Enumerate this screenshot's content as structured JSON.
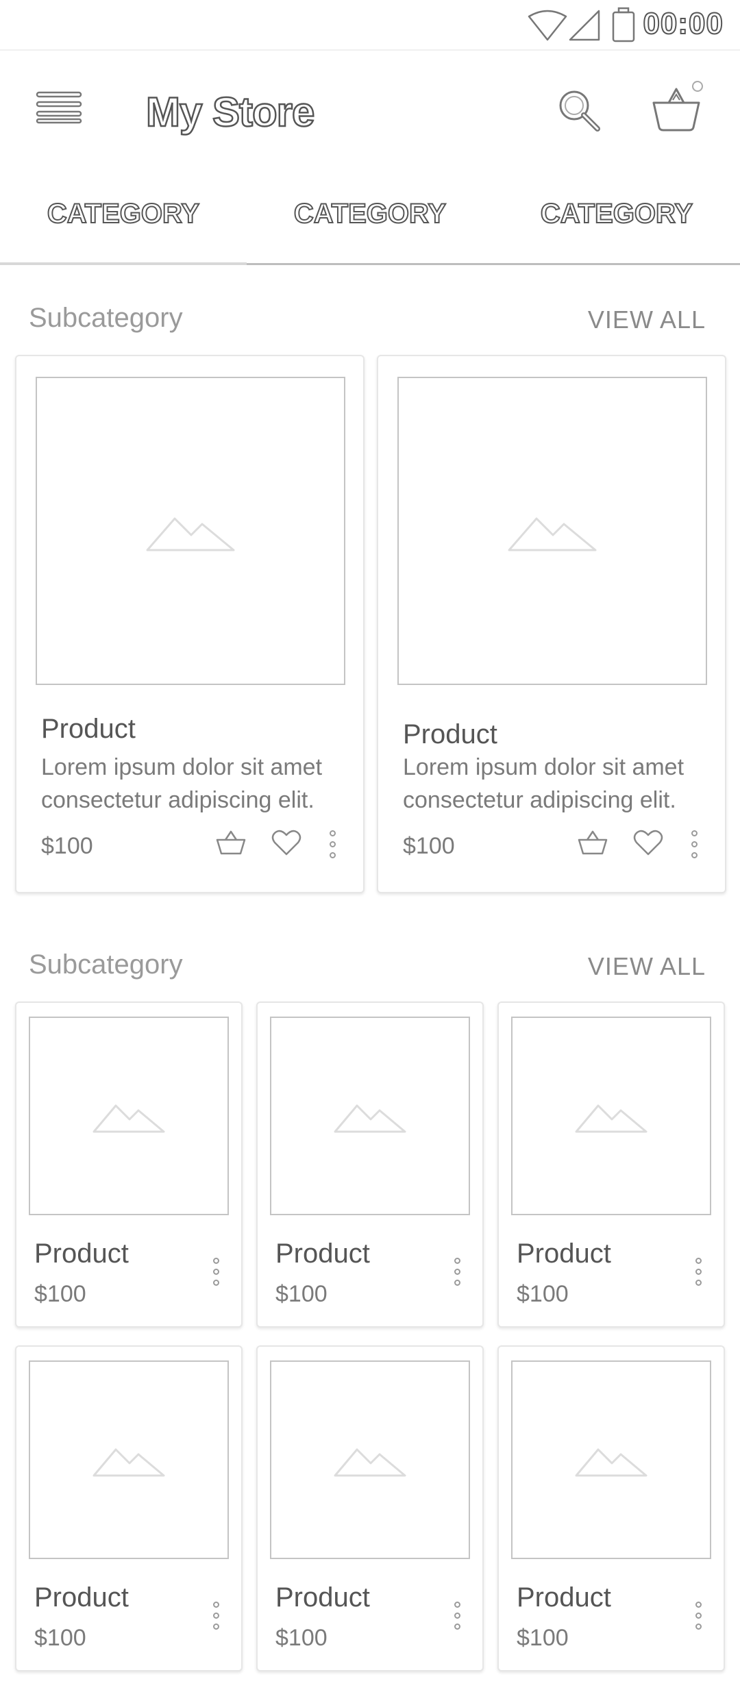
{
  "status_bar": {
    "time": "00:00",
    "icons": [
      "wifi-icon",
      "signal-icon",
      "battery-icon"
    ]
  },
  "app_bar": {
    "title": "My Store",
    "icons": [
      "menu-icon",
      "search-icon",
      "cart-icon"
    ]
  },
  "tabs": [
    {
      "label": "CATEGORY",
      "selected": true
    },
    {
      "label": "CATEGORY",
      "selected": false
    },
    {
      "label": "CATEGORY",
      "selected": false
    }
  ],
  "sections": [
    {
      "title": "Subcategory",
      "action": "VIEW ALL",
      "products": [
        {
          "name": "Product",
          "description": "Lorem ipsum dolor sit amet consectetur adipiscing elit.",
          "price": "$100"
        },
        {
          "name": "Product",
          "description": "Lorem ipsum dolor sit amet consectetur adipiscing elit.",
          "price": "$100"
        }
      ]
    },
    {
      "title": "Subcategory",
      "action": "VIEW ALL",
      "products": [
        {
          "name": "Product",
          "price": "$100"
        },
        {
          "name": "Product",
          "price": "$100"
        },
        {
          "name": "Product",
          "price": "$100"
        },
        {
          "name": "Product",
          "price": "$100"
        },
        {
          "name": "Product",
          "price": "$100"
        },
        {
          "name": "Product",
          "price": "$100"
        }
      ]
    }
  ]
}
